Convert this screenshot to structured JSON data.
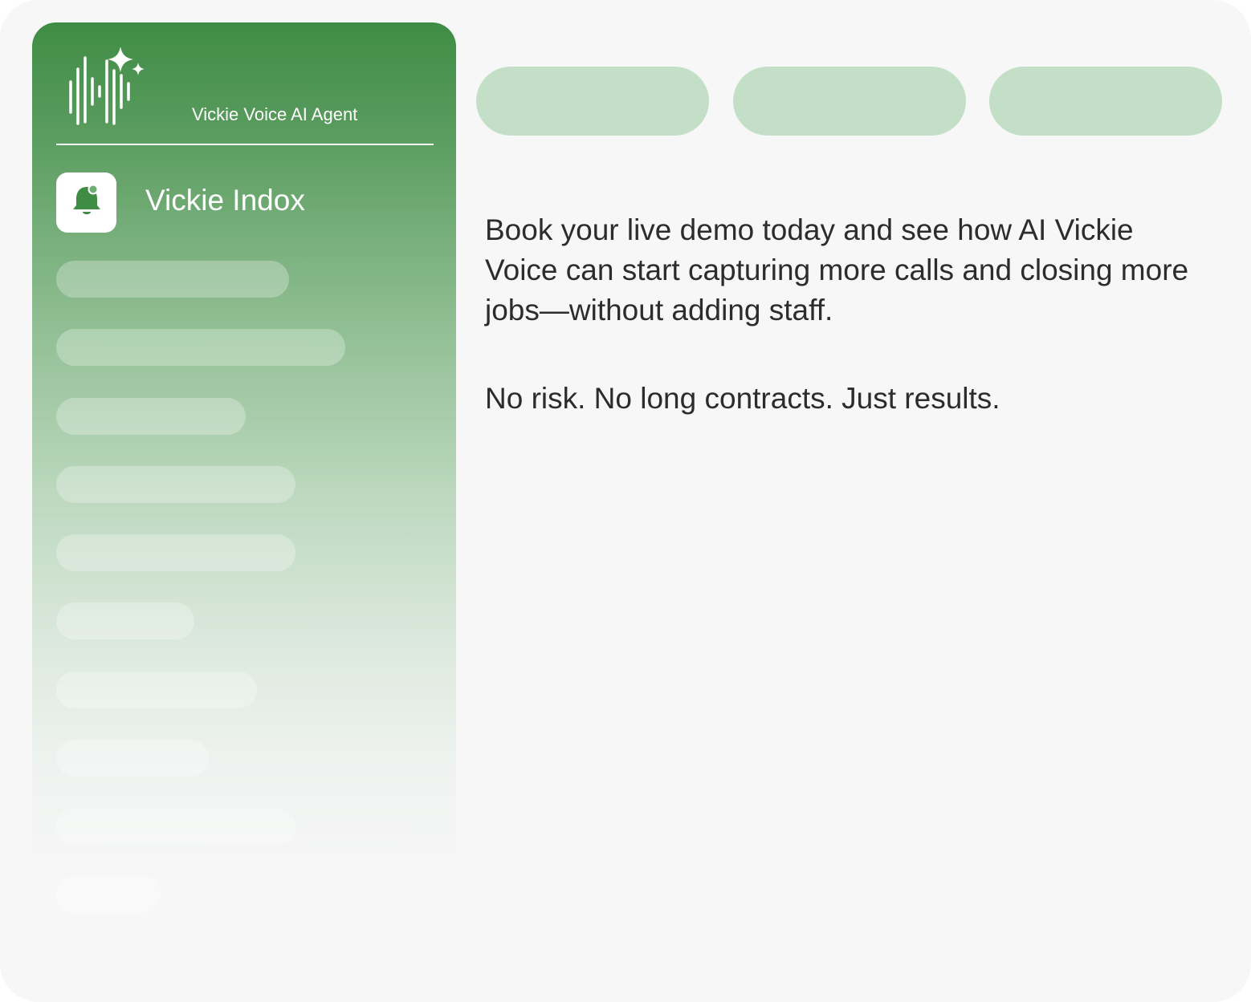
{
  "brand": {
    "name": "Vickie Voice AI Agent",
    "logo_icon": "voice-waveform-sparkle-icon",
    "color": "#ffffff"
  },
  "sidebar": {
    "gradient_top_color": "#3f8c45",
    "inbox": {
      "label": "Vickie Indox",
      "icon": "bell-icon",
      "icon_color": "#3f8c45"
    }
  },
  "tabs": {
    "color": "#c3dfc7"
  },
  "main": {
    "paragraph_1": "Book your live demo today and see how AI Vickie Voice can start capturing more calls and closing more jobs—without adding staff.",
    "paragraph_2": "No risk. No long contracts. Just results."
  }
}
